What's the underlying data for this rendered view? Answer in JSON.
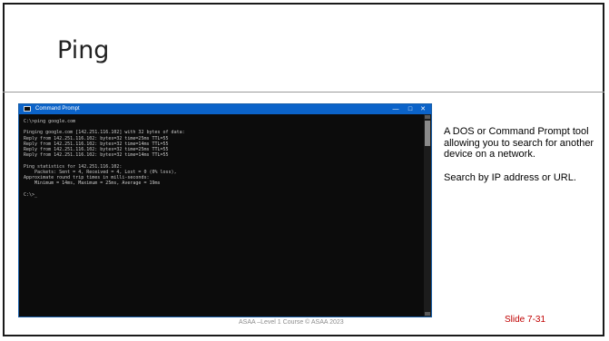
{
  "slide": {
    "title": "Ping",
    "description_paragraphs": [
      "A DOS or Command Prompt tool allowing you to search for another device on a network.",
      "Search by IP address or URL."
    ],
    "footer": "ASAA –Level 1 Course © ASAA 2023",
    "slide_number": "Slide 7-31"
  },
  "cmd": {
    "window_title": "Command Prompt",
    "controls": {
      "minimize": "—",
      "maximize": "□",
      "close": "✕"
    },
    "lines": [
      "C:\\>ping google.com",
      "",
      "Pinging google.com [142.251.116.102] with 32 bytes of data:",
      "Reply from 142.251.116.102: bytes=32 time=25ms TTL=55",
      "Reply from 142.251.116.102: bytes=32 time=14ms TTL=55",
      "Reply from 142.251.116.102: bytes=32 time=25ms TTL=55",
      "Reply from 142.251.116.102: bytes=32 time=14ms TTL=55",
      "",
      "Ping statistics for 142.251.116.102:",
      "    Packets: Sent = 4, Received = 4, Lost = 0 (0% loss),",
      "Approximate round trip times in milli-seconds:",
      "    Minimum = 14ms, Maximum = 25ms, Average = 19ms",
      "",
      "C:\\>_"
    ]
  },
  "colors": {
    "titlebar": "#0b63c9",
    "console_bg": "#0c0c0c",
    "console_text": "#c8c8c8",
    "slide_number": "#c00000"
  }
}
